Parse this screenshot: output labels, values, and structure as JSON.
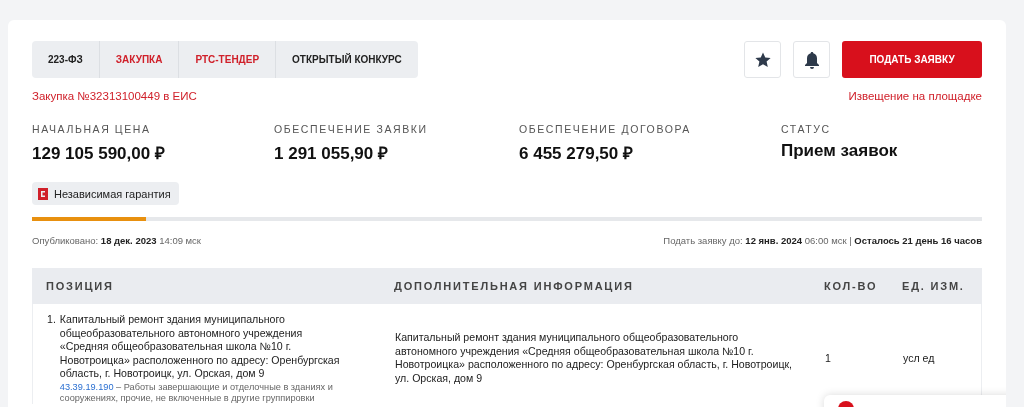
{
  "tags": [
    {
      "label": "223-ФЗ",
      "color": "#222222"
    },
    {
      "label": "ЗАКУПКА",
      "color": "#d0202a"
    },
    {
      "label": "РТС-ТЕНДЕР",
      "color": "#d0202a"
    },
    {
      "label": "ОТКРЫТЫЙ КОНКУРС",
      "color": "#222222"
    }
  ],
  "eis_link": "Закупка №32313100449 в ЕИС",
  "submit_button": "ПОДАТЬ ЗАЯВКУ",
  "notice_link": "Извещение на площадке",
  "stats": [
    {
      "label": "НАЧАЛЬНАЯ ЦЕНА",
      "value": "129 105 590,00 ₽"
    },
    {
      "label": "ОБЕСПЕЧЕНИЕ ЗАЯВКИ",
      "value": "1 291 055,90 ₽"
    },
    {
      "label": "ОБЕСПЕЧЕНИЕ ДОГОВОРА",
      "value": "6 455 279,50 ₽"
    },
    {
      "label": "СТАТУС",
      "value": "Прием заявок"
    }
  ],
  "guarantee_badge": "Независимая гарантия",
  "progress": {
    "level": 0.12
  },
  "published": "Опубликовано: **18 дек. 2023** 14:09 мск",
  "deadline": "Подать заявку до: **12 янв. 2024** 06:00 мск | **Осталось 21 день 16 часов**",
  "table": {
    "columns": [
      "ПОЗИЦИЯ",
      "ДОПОЛНИТЕЛЬНАЯ ИНФОРМАЦИЯ",
      "КОЛ-ВО",
      "ЕД. ИЗМ."
    ],
    "rows": [
      {
        "number": "1.",
        "position": "Капитальный ремонт здания муниципального общеобразовательного автономного учреждения «Средняя общеобразовательная школа №10 г. Новотроицка» расположенного по адресу: Оренбургская область, г. Новотроицк, ул. Орская, дом 9",
        "code": "43.39.19.190",
        "code_description": "– Работы завершающие и отделочные в зданиях и сооружениях, прочие, не включенные в другие группировки",
        "info": "Капитальный ремонт здания муниципального общеобразовательного автономного учреждения «Средняя общеобразовательная школа №10 г. Новотроицка» расположенного по адресу: Оренбургская область, г. Новотроицк, ул. Орская, дом 9",
        "quantity": "1",
        "unit": "усл ед"
      }
    ]
  }
}
